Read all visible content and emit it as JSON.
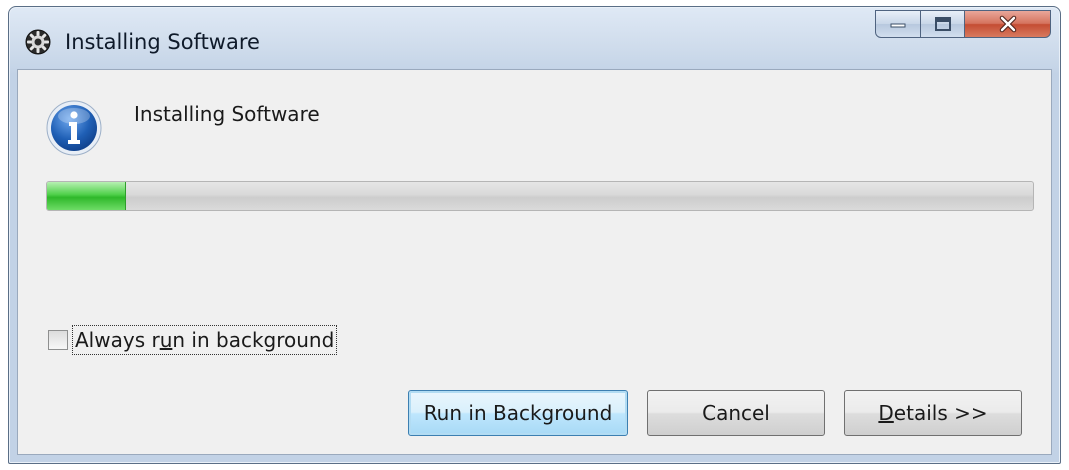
{
  "window": {
    "title": "Installing Software",
    "icon": "gear-icon",
    "caption_buttons": [
      "minimize-icon",
      "maximize-icon",
      "close-icon"
    ]
  },
  "dialog": {
    "message": "Installing Software",
    "icon": "info-icon",
    "progress_fraction": 0.08
  },
  "checkbox": {
    "label_before": "Always r",
    "label_underlined": "u",
    "label_after": "n in background",
    "checked": false
  },
  "buttons": {
    "run_in_background": "Run in Background",
    "cancel": "Cancel",
    "details_underlined": "D",
    "details_rest": "etails >>"
  },
  "colors": {
    "progress_green": "#2eb82a",
    "close_red": "#c44c33",
    "info_blue": "#1f5fb5"
  }
}
